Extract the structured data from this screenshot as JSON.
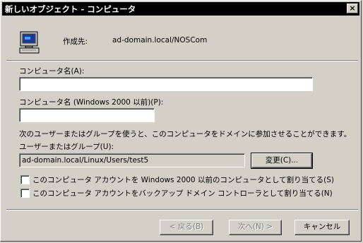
{
  "window": {
    "title": "新しいオブジェクト - コンピュータ",
    "close_glyph": "×"
  },
  "header": {
    "create_in_label": "作成先:",
    "create_in_value": "ad-domain.local/NOSCom"
  },
  "form": {
    "computer_name_label": "コンピュータ名(A):",
    "computer_name_value": "",
    "pre2000_name_label": "コンピュータ名 (Windows 2000 以前)(P):",
    "pre2000_name_value": "",
    "join_info": "次のユーザーまたはグループを使うと、このコンピュータをドメインに参加させることができます。",
    "user_group_label": "ユーザーまたはグループ(U):",
    "user_group_value": "ad-domain.local/Linux/Users/test5",
    "change_button": "変更(C)...",
    "checkbox_pre2000": "このコンピュータ アカウントを Windows 2000 以前のコンピュータとして割り当てる(S)",
    "checkbox_backup": "このコンピュータ アカウントをバックアップ ドメイン コントローラとして割り当てる(N)"
  },
  "footer": {
    "back": "< 戻る(B)",
    "next": "次へ(N) >",
    "cancel": "キャンセル"
  }
}
